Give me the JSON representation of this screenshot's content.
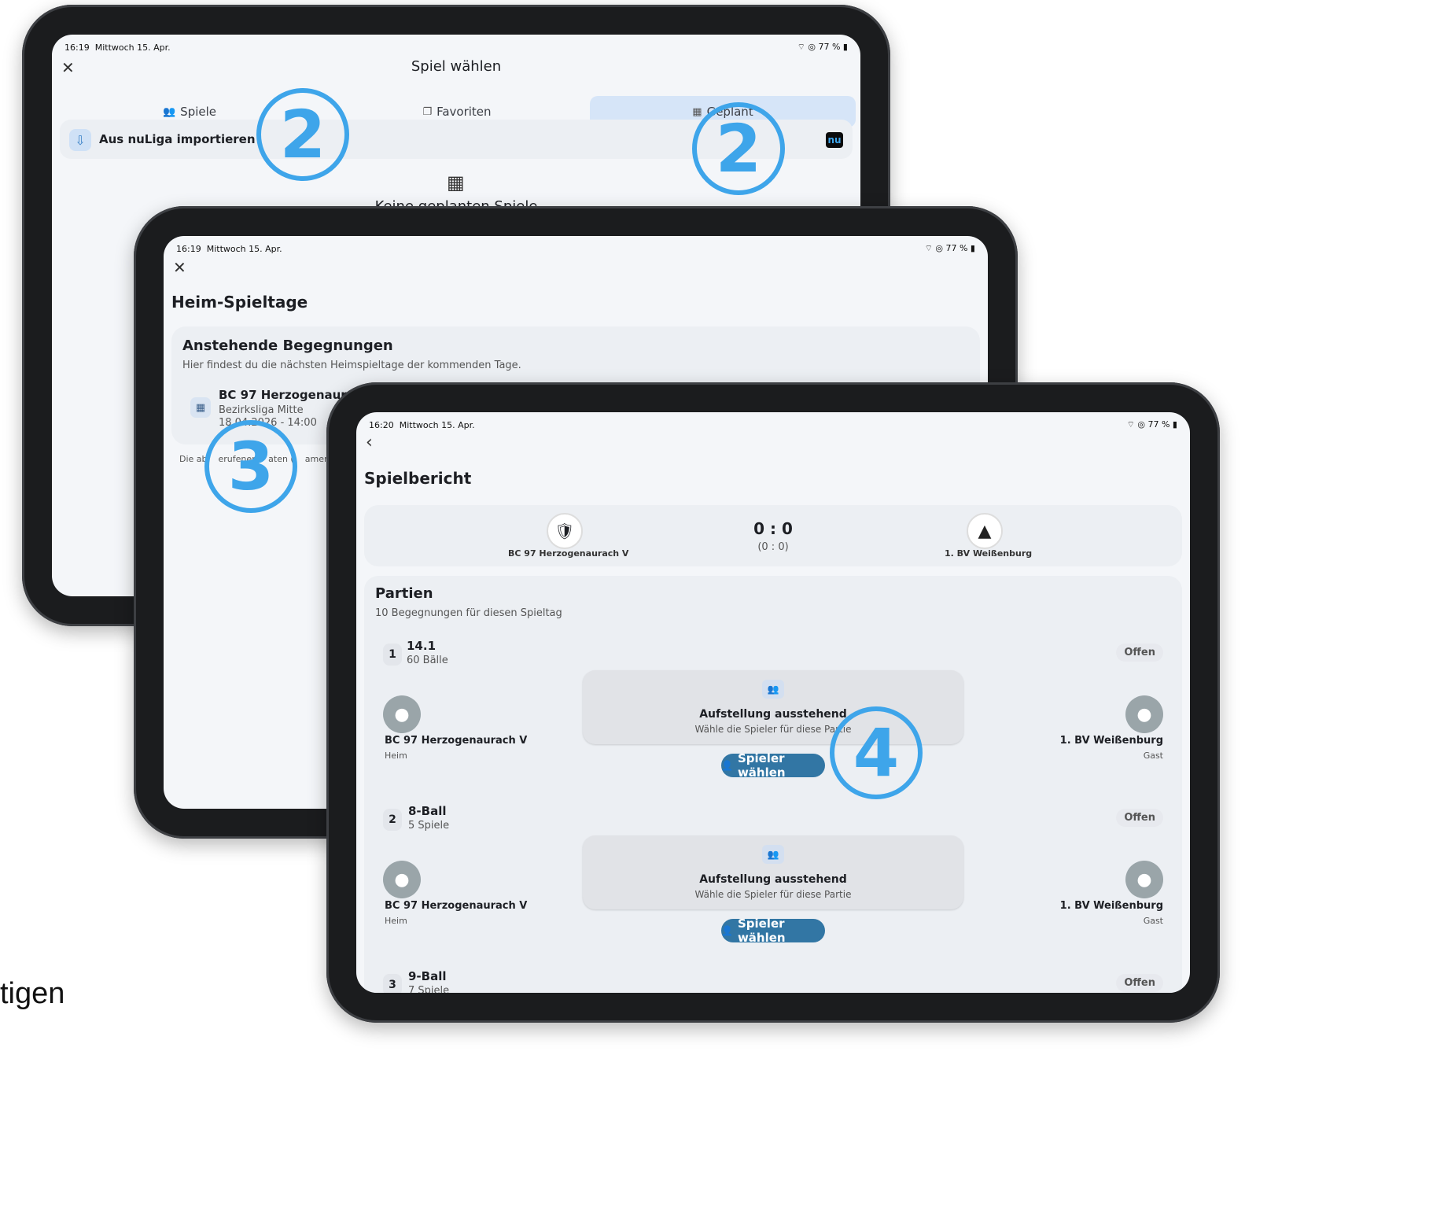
{
  "statusbar": {
    "t1_time": "16:19",
    "t1_date": "Mittwoch 15. Apr.",
    "t1_right": "⌔ ◎ 77 % ▮",
    "t2_time": "16:19",
    "t2_date": "Mittwoch 15. Apr.",
    "t2_right": "⌔ ◎ 77 % ▮",
    "t3_time": "16:20",
    "t3_date": "Mittwoch 15. Apr.",
    "t3_right": "⌔ ◎ 77 % ▮"
  },
  "screen1": {
    "title": "Spiel wählen",
    "tabs": [
      {
        "label": "Spiele",
        "icon": "users-icon"
      },
      {
        "label": "Favoriten",
        "icon": "copy-icon"
      },
      {
        "label": "Geplant",
        "icon": "calendar-icon"
      }
    ],
    "import_label": "Aus nuLiga importieren",
    "nu_badge": "nu",
    "empty_label": "Keine geplanten Spiele"
  },
  "screen2": {
    "title": "Heim-Spieltage",
    "card_title": "Anstehende Begegnungen",
    "card_sub": "Hier findest du die nächsten Heimspieltage der kommenden Tage.",
    "match_team": "BC 97 Herzogenaurac",
    "match_league": "Bezirksliga Mitte",
    "match_date": "18.04.2026 - 14:00",
    "footer_text_a": "Die ab",
    "footer_text_b": "erufenen",
    "footer_text_c": "aten (",
    "footer_text_d": "amen, Fot"
  },
  "screen3": {
    "title": "Spielbericht",
    "home_team": "BC 97 Herzogenaurach V",
    "away_team": "1. BV Weißenburg",
    "score": "0 : 0",
    "score_sub": "(0 : 0)",
    "section_title": "Partien",
    "section_sub": "10 Begegnungen für diesen Spieltag",
    "matches": [
      {
        "num": "1",
        "name": "14.1",
        "detail": "60 Bälle",
        "status": "Offen",
        "pending": "Aufstellung ausstehend",
        "pending_sub": "Wähle die Spieler für diese Partie",
        "btn": "Spieler wählen",
        "home": "BC 97 Herzogenaurach V",
        "home_role": "Heim",
        "away": "1. BV Weißenburg",
        "away_role": "Gast"
      },
      {
        "num": "2",
        "name": "8-Ball",
        "detail": "5 Spiele",
        "status": "Offen",
        "pending": "Aufstellung ausstehend",
        "pending_sub": "Wähle die Spieler für diese Partie",
        "btn": "Spieler wählen",
        "home": "BC 97 Herzogenaurach V",
        "home_role": "Heim",
        "away": "1. BV Weißenburg",
        "away_role": "Gast"
      },
      {
        "num": "3",
        "name": "9-Ball",
        "detail": "7 Spiele",
        "status": "Offen"
      }
    ]
  },
  "callouts": [
    "2",
    "2",
    "3",
    "4"
  ],
  "edge_text": "tigen",
  "colors": {
    "accent": "#3ea5ea",
    "button": "#3276a4",
    "tab_active": "#d6e5f8"
  }
}
